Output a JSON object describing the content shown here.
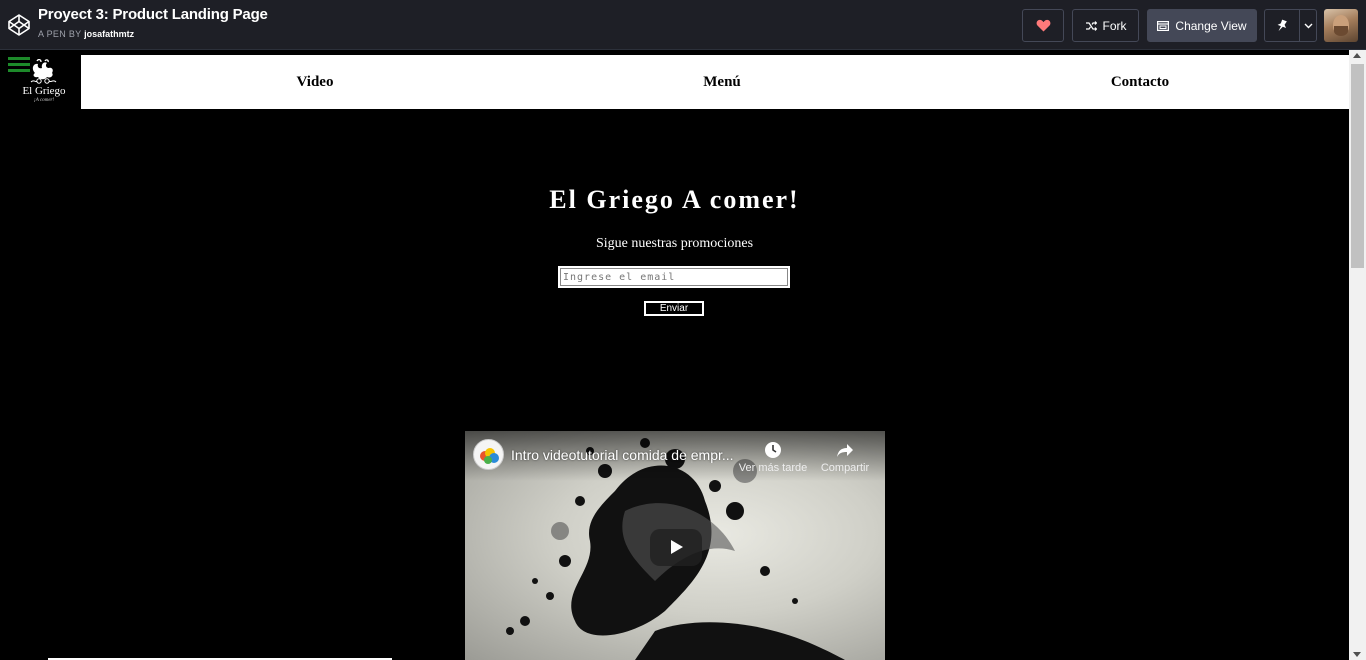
{
  "codepen": {
    "title": "Proyect 3: Product Landing Page",
    "author_prefix": "A PEN BY",
    "author": "josafathmtz",
    "fork_label": "Fork",
    "change_view_label": "Change View",
    "icons": [
      "codepen-logo-icon",
      "heart-icon",
      "fork-icon",
      "change-view-icon",
      "pin-icon",
      "chevron-down-icon"
    ],
    "heart_color": "#ff7a7a"
  },
  "site": {
    "logo_text": "El Griego",
    "logo_sub": "¡A comer!",
    "nav": {
      "video": "Video",
      "menu": "Menú",
      "contact": "Contacto"
    },
    "hero": {
      "title": "El Griego A comer!",
      "subtitle": "Sigue nuestras promociones",
      "email_placeholder": "Ingrese el email",
      "submit_label": "Enviar"
    },
    "video": {
      "title": "Intro videotutorial comida de empr...",
      "watch_later": "Ver más tarde",
      "share": "Compartir"
    }
  }
}
